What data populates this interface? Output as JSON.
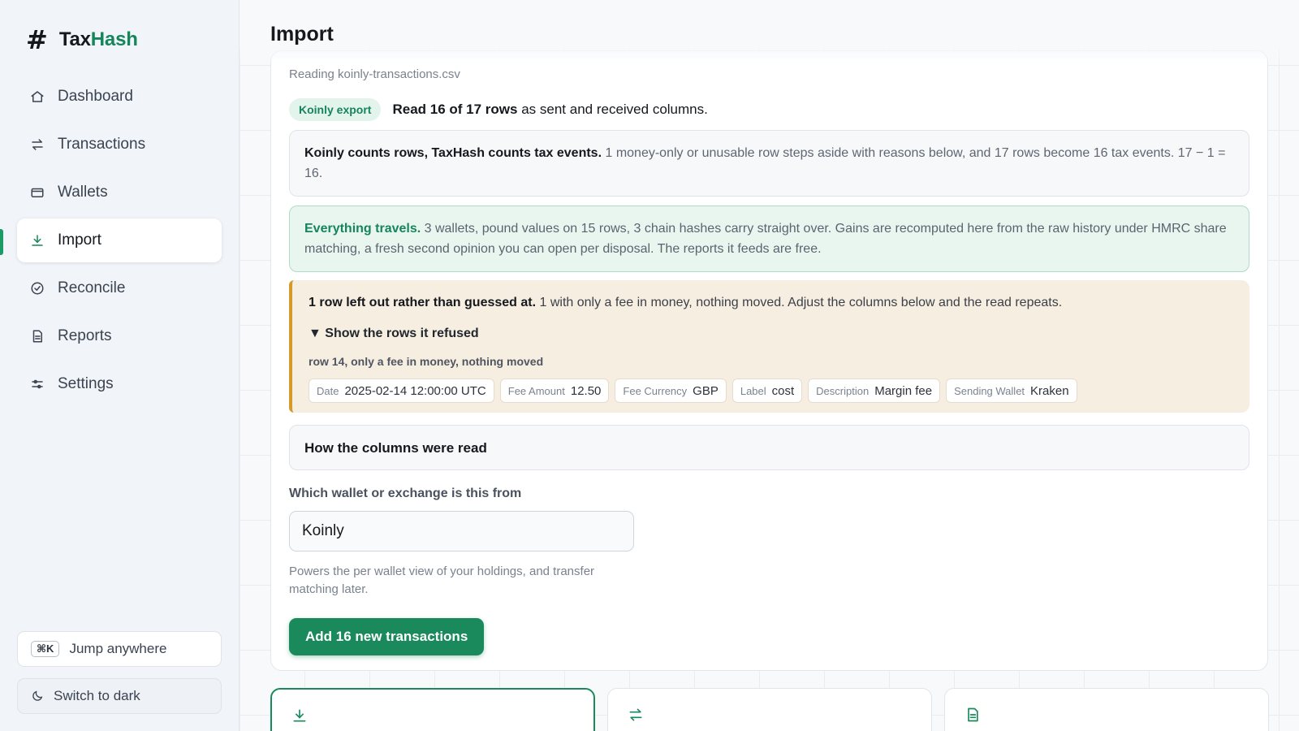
{
  "brand": {
    "mark": "#",
    "name_part1": "Tax",
    "name_part2": "Hash"
  },
  "sidebar": {
    "items": [
      {
        "label": "Dashboard",
        "icon": "home-icon"
      },
      {
        "label": "Transactions",
        "icon": "swap-icon"
      },
      {
        "label": "Wallets",
        "icon": "wallet-icon"
      },
      {
        "label": "Import",
        "icon": "download-icon",
        "active": true
      },
      {
        "label": "Reconcile",
        "icon": "check-circle-icon"
      },
      {
        "label": "Reports",
        "icon": "document-icon"
      },
      {
        "label": "Settings",
        "icon": "sliders-icon"
      }
    ],
    "jump": {
      "kbd": "⌘K",
      "label": "Jump anywhere"
    },
    "theme": {
      "label": "Switch to dark"
    }
  },
  "page": {
    "title": "Import"
  },
  "import": {
    "reading": "Reading koinly-transactions.csv",
    "tag": "Koinly export",
    "summary_bold": "Read 16 of 17 rows",
    "summary_rest": "as sent and received columns.",
    "counts": {
      "bold": "Koinly counts rows, TaxHash counts tax events.",
      "text": "1 money-only or unusable row steps aside with reasons below, and 17 rows become 16 tax events. 17 − 1 = 16."
    },
    "travels": {
      "bold": "Everything travels.",
      "text": "3 wallets, pound values on 15 rows, 3 chain hashes carry straight over. Gains are recomputed here from the raw history under HMRC share matching, a fresh second opinion you can open per disposal. The reports it feeds are free."
    },
    "refused": {
      "bold": "1 row left out rather than guessed at.",
      "text": "1 with only a fee in money, nothing moved. Adjust the columns below and the read repeats.",
      "toggle": "Show the rows it refused",
      "row_note": "row 14, only a fee in money, nothing moved",
      "fields": [
        {
          "key": "Date",
          "value": "2025-02-14 12:00:00 UTC"
        },
        {
          "key": "Fee Amount",
          "value": "12.50"
        },
        {
          "key": "Fee Currency",
          "value": "GBP"
        },
        {
          "key": "Label",
          "value": "cost"
        },
        {
          "key": "Description",
          "value": "Margin fee"
        },
        {
          "key": "Sending Wallet",
          "value": "Kraken"
        }
      ]
    },
    "columns_heading": "How the columns were read",
    "wallet_label": "Which wallet or exchange is this from",
    "wallet_value": "Koinly",
    "wallet_hint": "Powers the per wallet view of your holdings, and transfer matching later.",
    "add_button": "Add 16 new transactions"
  },
  "tiles": [
    {
      "icon": "download-icon",
      "selected": true
    },
    {
      "icon": "swap-icon",
      "selected": false
    },
    {
      "icon": "document-icon",
      "selected": false
    }
  ],
  "colors": {
    "accent": "#16855a",
    "warning": "#d49a2a"
  }
}
